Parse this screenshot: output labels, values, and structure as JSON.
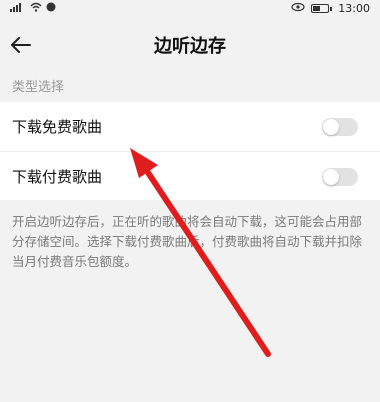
{
  "status_bar": {
    "signal_text": "4G",
    "time": "13:00"
  },
  "header": {
    "title": "边听边存",
    "back_icon": "arrow-left-icon"
  },
  "section": {
    "label": "类型选择"
  },
  "settings": [
    {
      "label": "下载免费歌曲",
      "enabled": false
    },
    {
      "label": "下载付费歌曲",
      "enabled": false
    }
  ],
  "description": "开启边听边存后，正在听的歌曲将会自动下载，这可能会占用部分存储空间。选择下载付费歌曲后，付费歌曲将自动下载并扣除当月付费音乐包额度。",
  "annotation": {
    "arrow_color": "#e01c1c"
  }
}
